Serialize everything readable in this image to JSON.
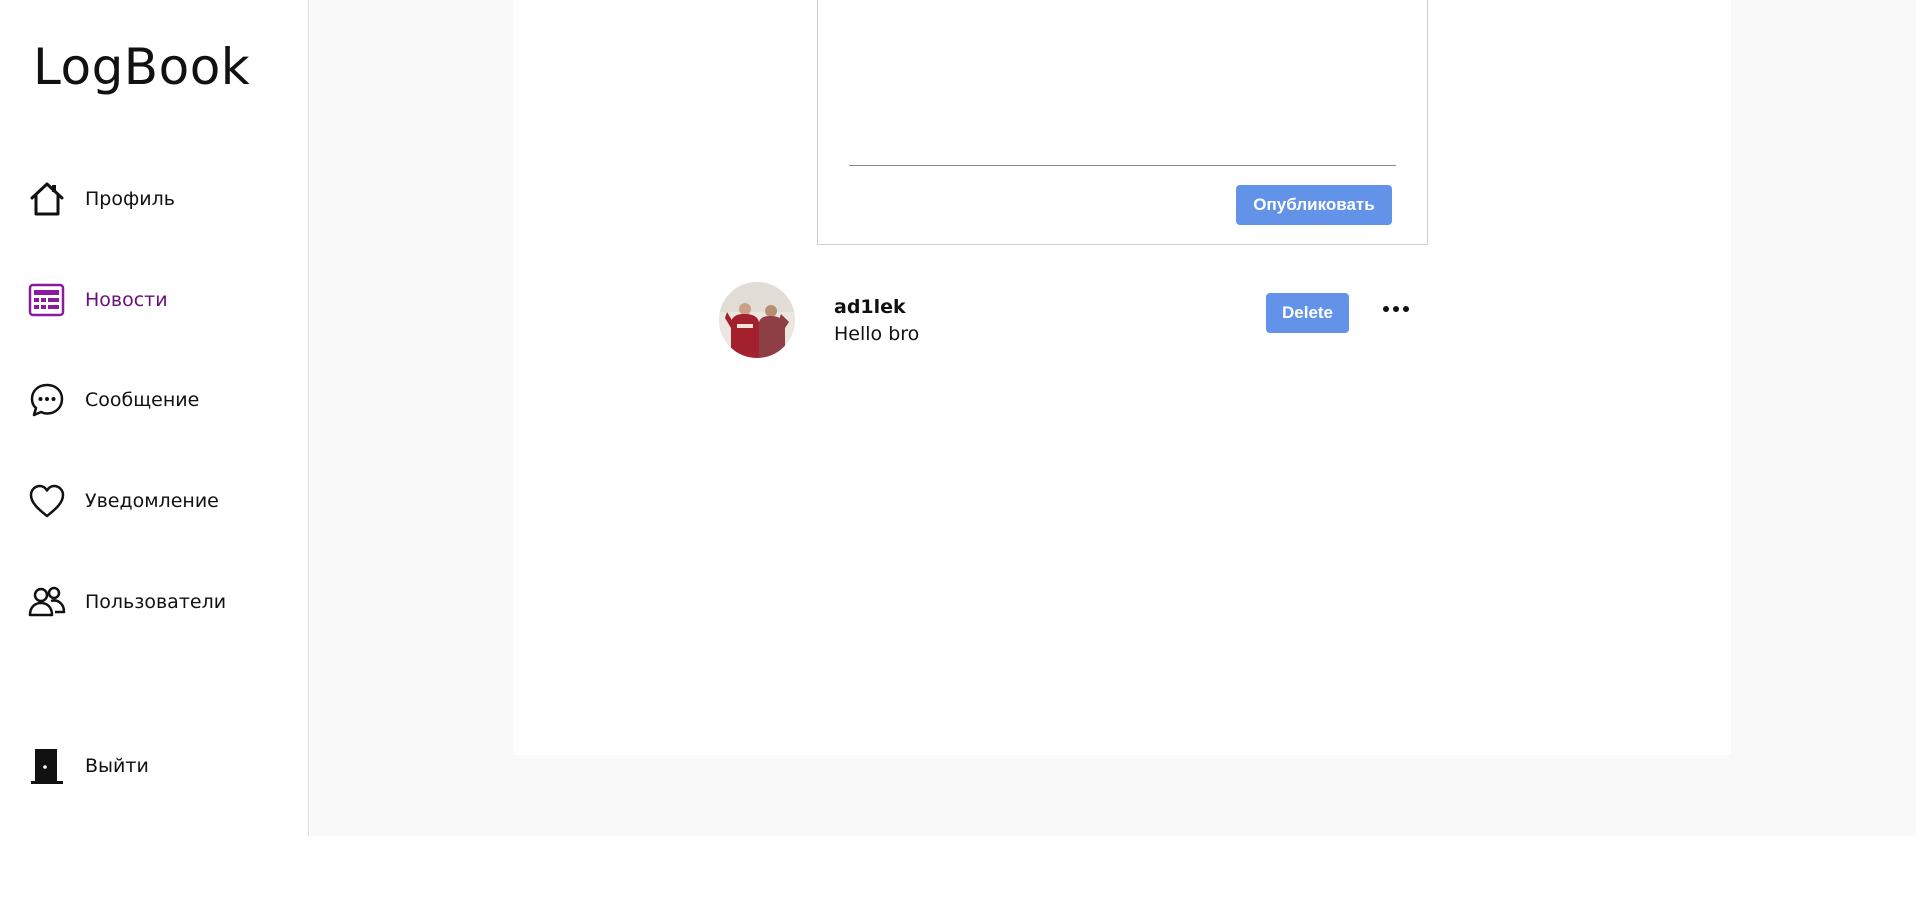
{
  "app": {
    "title": "LogBook"
  },
  "sidebar": {
    "items": [
      {
        "label": "Профиль",
        "icon": "home-icon",
        "active": false
      },
      {
        "label": "Новости",
        "icon": "newspaper-icon",
        "active": true
      },
      {
        "label": "Сообщение",
        "icon": "chat-bubble-icon",
        "active": false
      },
      {
        "label": "Уведомление",
        "icon": "heart-icon",
        "active": false
      },
      {
        "label": "Пользователи",
        "icon": "users-icon",
        "active": false
      }
    ],
    "logout": {
      "label": "Выйти",
      "icon": "door-icon"
    }
  },
  "composer": {
    "publish_label": "Опубликовать"
  },
  "post": {
    "author": "ad1lek",
    "text": "Hello bro",
    "delete_label": "Delete",
    "more_icon": "more-horizontal-icon"
  },
  "colors": {
    "accent": "#6393e8",
    "active_nav": "#6a0f7a",
    "main_bg": "#f9f9f9",
    "border": "#dbdbdb"
  }
}
